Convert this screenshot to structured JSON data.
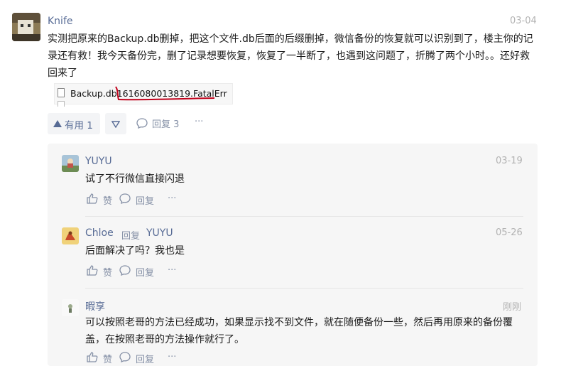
{
  "comment": {
    "username": "Knife",
    "date": "03-04",
    "text_lines": [
      "实测把原来的Backup.db删掉，把这个文件.db后面的后缀删掉，微信备份的恢复就可以识别到了，楼主你的记",
      "录还有救！我今天备份完，删了记录想要恢复，恢复了一半断了，也遇到这问题了，折腾了两个小时。。还好救",
      "回来了"
    ],
    "attachment_name": "Backup.db1616080013819.FatalErr",
    "useful_label": "有用 1",
    "reply_label": "回复 3",
    "more_label": "···"
  },
  "replies": [
    {
      "username": "YUYU",
      "reply_prefix": "",
      "reply_target": "",
      "date": "03-19",
      "text_lines": [
        "试了不行微信直接闪退"
      ],
      "like_label": "赞",
      "reply_label": "回复",
      "more_label": "···"
    },
    {
      "username": "Chloe",
      "reply_prefix": "回复",
      "reply_target": "YUYU",
      "date": "05-26",
      "text_lines": [
        "后面解决了吗？我也是"
      ],
      "like_label": "赞",
      "reply_label": "回复",
      "more_label": "···"
    },
    {
      "username": "暇享",
      "reply_prefix": "",
      "reply_target": "",
      "date": "刚刚",
      "text_lines": [
        "可以按照老哥的方法已经成功，如果显示找不到文件，就在随便备份一些，然后再用原来的备份覆",
        "盖，在按照老哥的方法操作就行了。"
      ],
      "like_label": "赞",
      "reply_label": "回复",
      "more_label": "···"
    }
  ],
  "colors": {
    "username": "#576b95",
    "muted": "#b2b2b2",
    "action": "#8590a6",
    "reply_bg": "#f6f6f6",
    "annotation_red": "#c0001a"
  }
}
